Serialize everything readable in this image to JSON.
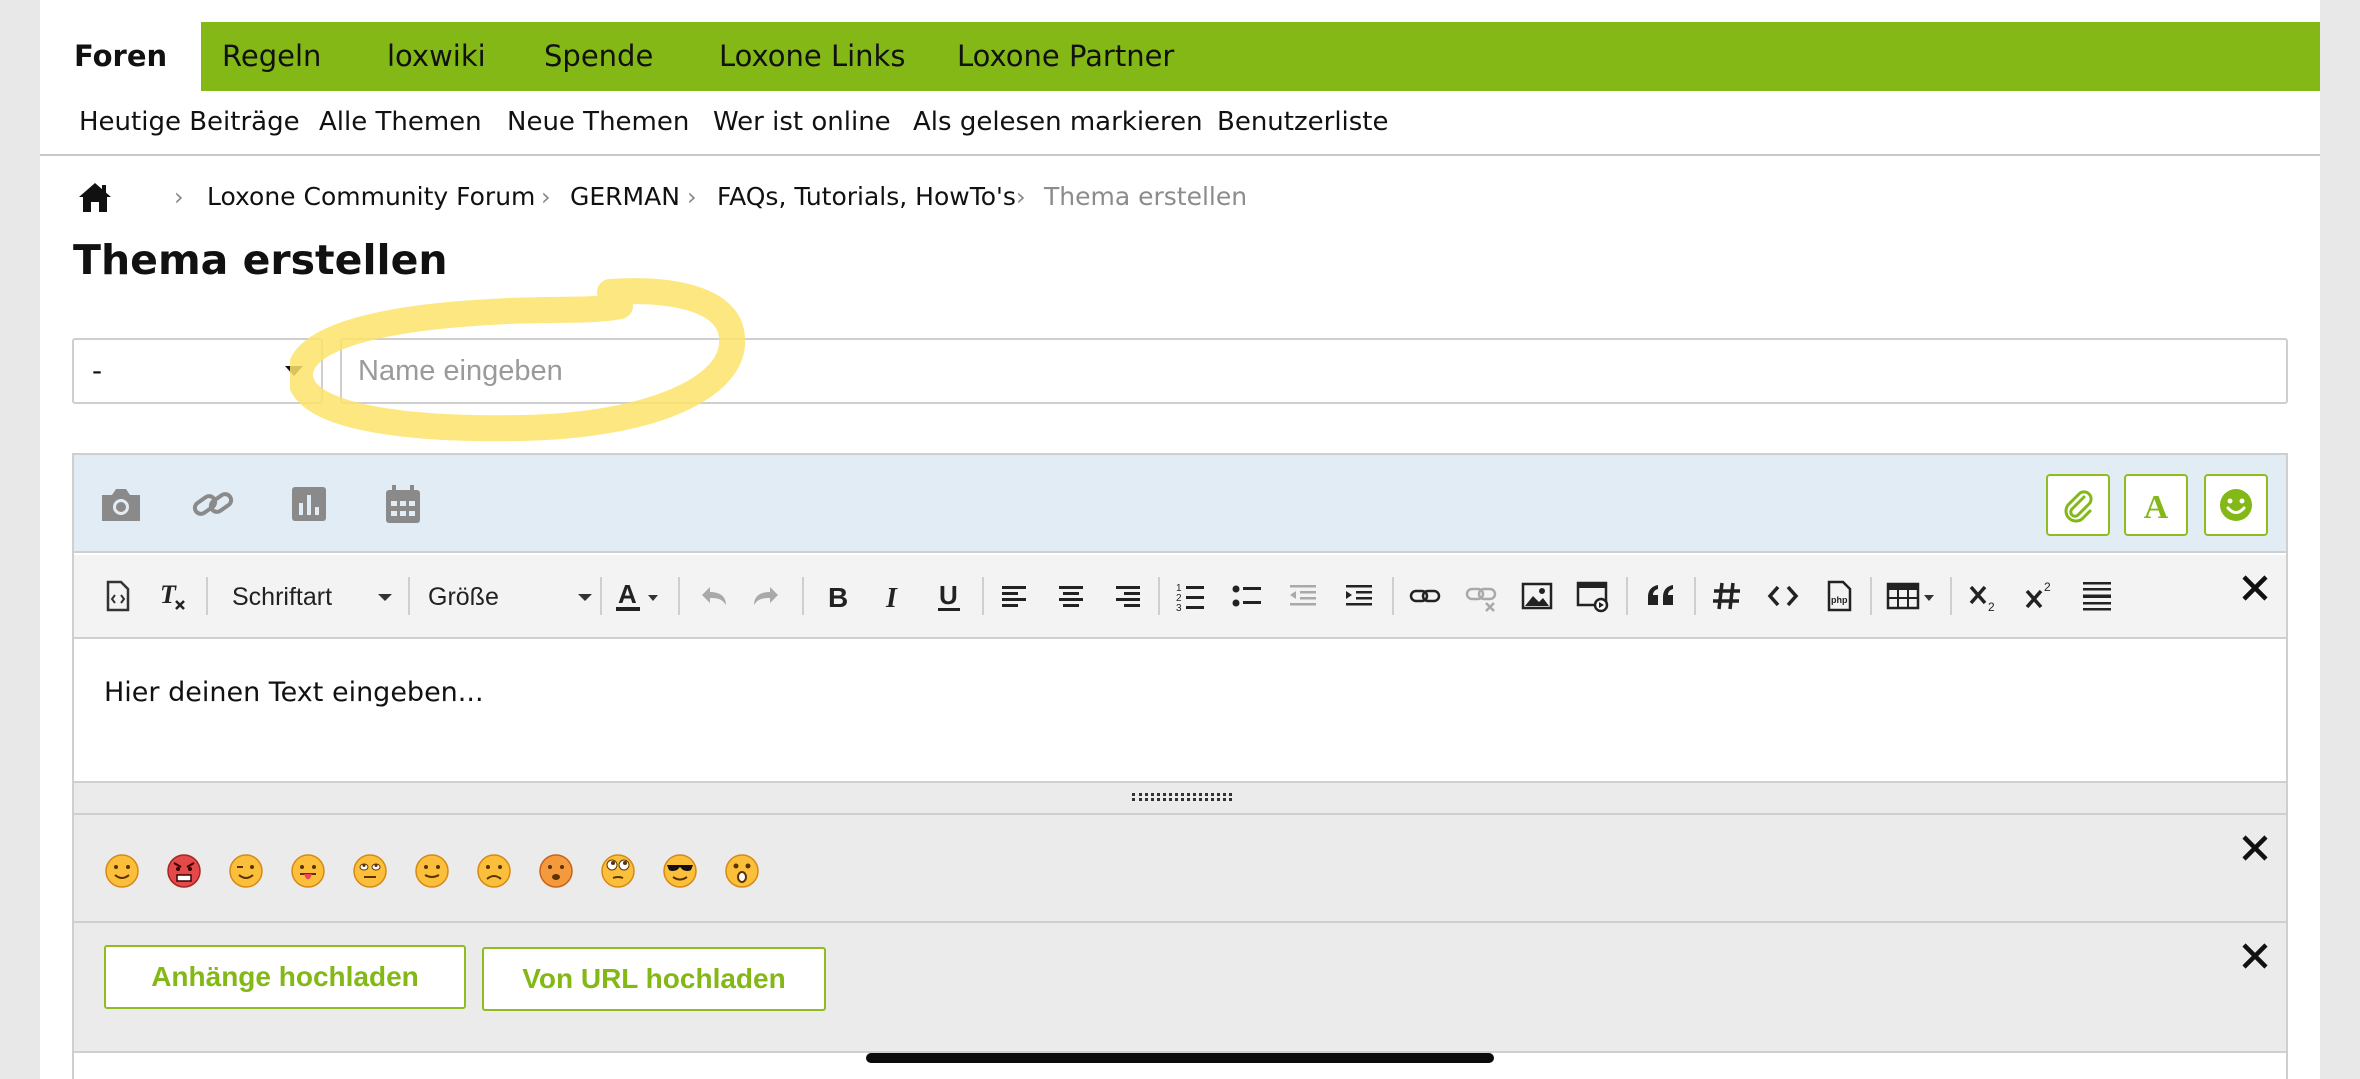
{
  "nav": {
    "tabs": [
      {
        "label": "Foren",
        "active": true
      },
      {
        "label": "Regeln"
      },
      {
        "label": "loxwiki"
      },
      {
        "label": "Spende"
      },
      {
        "label": "Loxone Links"
      },
      {
        "label": "Loxone Partner"
      }
    ],
    "sublinks": [
      "Heutige Beiträge",
      "Alle Themen",
      "Neue Themen",
      "Wer ist online",
      "Als gelesen markieren",
      "Benutzerliste"
    ]
  },
  "breadcrumb": {
    "items": [
      "Loxone Community Forum",
      "GERMAN",
      "FAQs, Tutorials, HowTo's"
    ],
    "current": "Thema erstellen"
  },
  "page": {
    "title": "Thema erstellen"
  },
  "form": {
    "prefix_value": "-",
    "subject_placeholder": "Name eingeben",
    "subject_value": ""
  },
  "editor": {
    "font_select": "Schriftart",
    "size_select": "Größe",
    "placeholder_text": "Hier deinen Text eingeben...",
    "smiley_count": 11
  },
  "attachments": {
    "upload_label": "Anhänge hochladen",
    "url_upload_label": "Von URL hochladen"
  },
  "colors": {
    "brand_green": "#83b817",
    "quickbar_bg": "#e1ecf4",
    "highlight": "#fde36a"
  }
}
